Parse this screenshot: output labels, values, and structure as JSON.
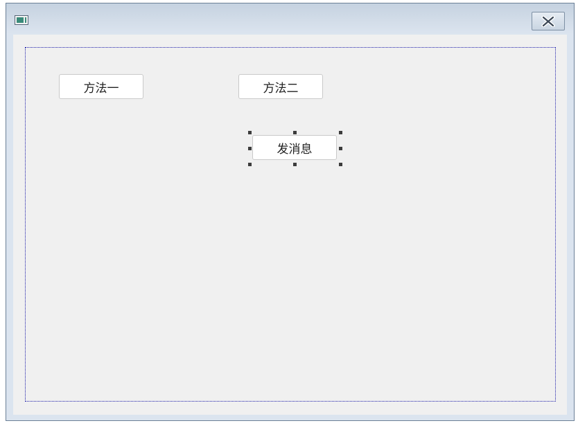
{
  "window": {
    "title": "",
    "icon": "app-window-icon",
    "close_icon": "close-icon"
  },
  "form": {
    "buttons": {
      "method_one": "方法一",
      "method_two": "方法二",
      "send_message": "发消息"
    },
    "selected_control": "send_message"
  },
  "colors": {
    "titlebar": "#c5d2e0",
    "client_background": "#f0f0f0",
    "design_border": "#1a1aa8",
    "selection_handle": "#3c3c3c"
  }
}
